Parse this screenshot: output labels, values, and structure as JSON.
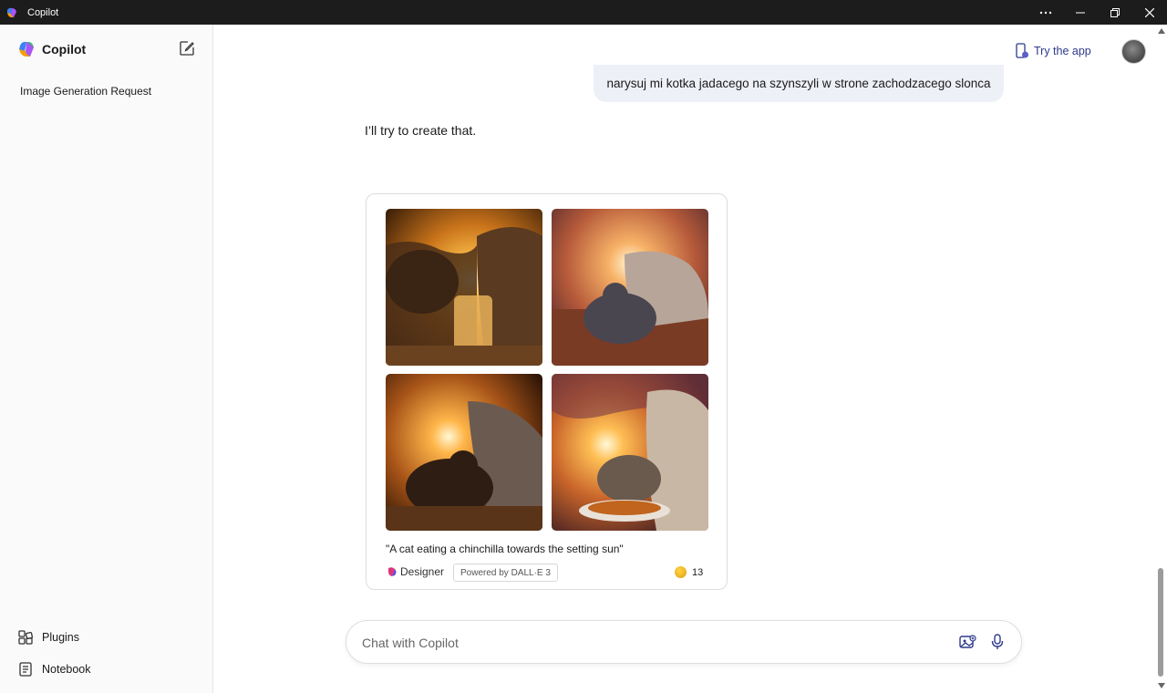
{
  "window": {
    "title": "Copilot",
    "controls": [
      "more-icon",
      "minimize-icon",
      "restore-icon",
      "close-icon"
    ]
  },
  "sidebar": {
    "brand": "Copilot",
    "history": [
      {
        "label": "Image Generation Request"
      }
    ],
    "links": [
      {
        "label": "Plugins",
        "icon": "plugins-icon"
      },
      {
        "label": "Notebook",
        "icon": "notebook-icon"
      }
    ]
  },
  "header": {
    "try_app": "Try the app"
  },
  "conversation": {
    "user_message": "narysuj mi kotka jadacego na szynszyli w strone zachodzacego slonca",
    "bot_message": "I’ll try to create that.",
    "image_card": {
      "caption": "\"A cat eating a chinchilla towards the setting sun\"",
      "designer_label": "Designer",
      "powered_by": "Powered by DALL·E 3",
      "boost_count": "13"
    }
  },
  "input": {
    "placeholder": "Chat with Copilot"
  },
  "colors": {
    "accent": "#2e3a8c",
    "user_bubble": "#eef0f8",
    "titlebar": "#1c1c1c"
  }
}
